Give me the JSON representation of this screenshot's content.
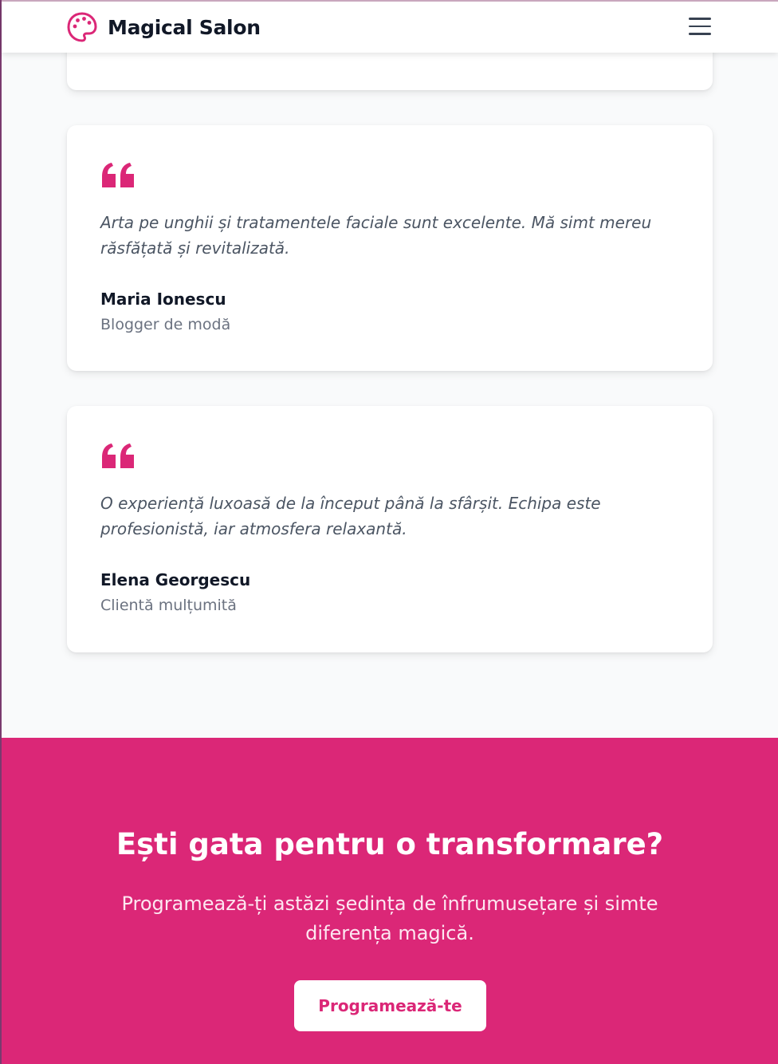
{
  "header": {
    "brand": "Magical Salon",
    "logo_icon": "palette-icon",
    "menu_icon": "hamburger-menu-icon"
  },
  "testimonials": [
    {
      "quote": "Arta pe unghii și tratamentele faciale sunt excelente. Mă simt mereu răsfățată și revitalizată.",
      "author": "Maria Ionescu",
      "role": "Blogger de modă"
    },
    {
      "quote": "O experiență luxoasă de la început până la sfârșit. Echipa este profesionistă, iar atmosfera relaxantă.",
      "author": "Elena Georgescu",
      "role": "Clientă mulțumită"
    }
  ],
  "cta": {
    "title": "Ești gata pentru o transformare?",
    "subtitle": "Programează-ți astăzi ședința de înfrumusețare și simte diferența magică.",
    "button": "Programează-te"
  },
  "colors": {
    "accent": "#db2777",
    "text_dark": "#111827",
    "text_muted": "#6b7280"
  }
}
